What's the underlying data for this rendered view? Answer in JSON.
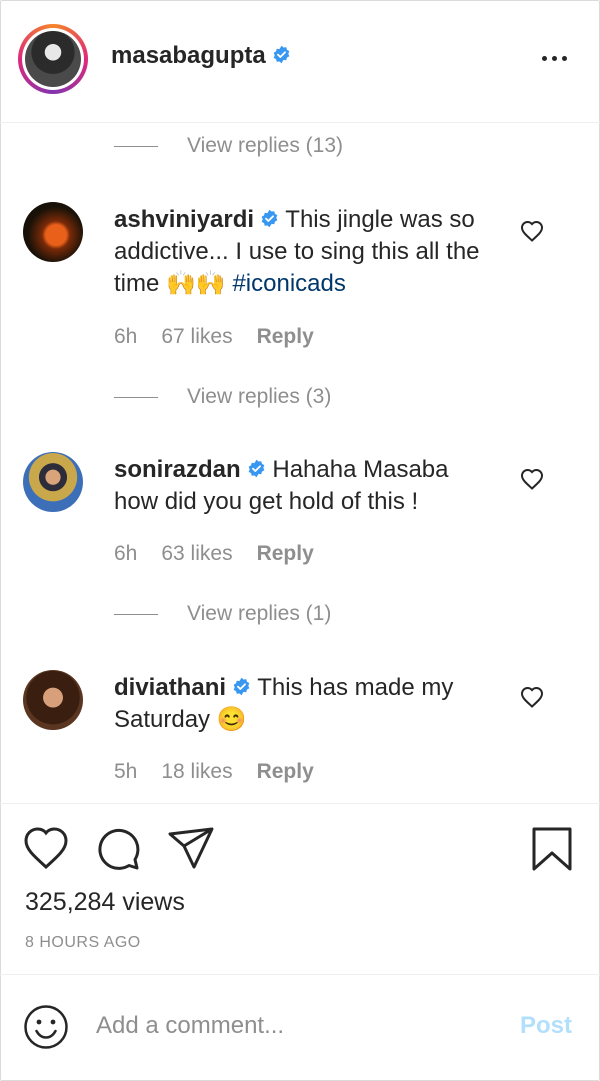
{
  "header": {
    "username": "masabagupta",
    "verified_icon": "verified-badge-icon",
    "more_icon": "more-options-icon"
  },
  "comments": [
    {
      "view_replies_before": "View replies (13)",
      "username": "ashviniyardi",
      "text_pre": "This jingle was so addictive... I use to sing this all the time 🙌🙌 ",
      "hashtag": "#iconicads",
      "time": "6h",
      "likes": "67 likes",
      "reply": "Reply"
    },
    {
      "view_replies_before": "View replies (3)",
      "username": "sonirazdan",
      "text_pre": "Hahaha Masaba how did you get hold of this !",
      "hashtag": "",
      "time": "6h",
      "likes": "63 likes",
      "reply": "Reply"
    },
    {
      "view_replies_before": "View replies (1)",
      "username": "diviathani",
      "text_pre": "This has made my Saturday 😊",
      "hashtag": "",
      "time": "5h",
      "likes": "18 likes",
      "reply": "Reply"
    }
  ],
  "post": {
    "views": "325,284 views",
    "time_ago": "8 HOURS AGO"
  },
  "comment_box": {
    "placeholder": "Add a comment...",
    "post_label": "Post"
  },
  "colors": {
    "verified": "#3897f0",
    "link": "#00376b",
    "secondary": "#8e8e8e",
    "post_disabled": "#b2dffc"
  }
}
